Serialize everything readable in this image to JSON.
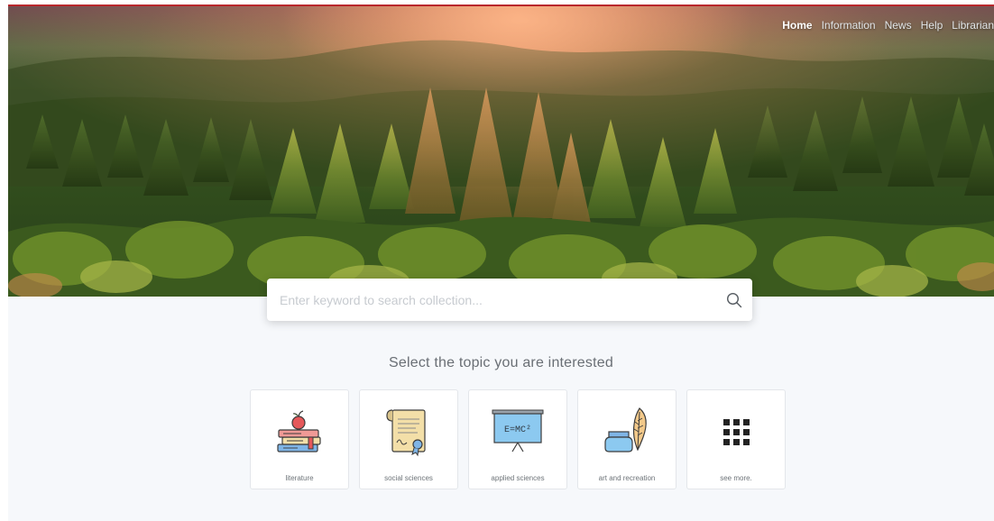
{
  "nav": {
    "items": [
      {
        "label": "Home",
        "active": true
      },
      {
        "label": "Information",
        "active": false
      },
      {
        "label": "News",
        "active": false
      },
      {
        "label": "Help",
        "active": false
      },
      {
        "label": "Librarian",
        "active": false
      }
    ]
  },
  "search": {
    "placeholder": "Enter keyword to search collection...",
    "icon": "search-icon"
  },
  "topics": {
    "heading": "Select the topic you are interested",
    "items": [
      {
        "label": "literature",
        "icon": "books-apple-icon"
      },
      {
        "label": "social sciences",
        "icon": "certificate-scroll-icon"
      },
      {
        "label": "applied sciences",
        "icon": "whiteboard-formula-icon"
      },
      {
        "label": "art and recreation",
        "icon": "ink-feather-icon"
      },
      {
        "label": "see more.",
        "icon": "grid-dots-icon"
      }
    ],
    "formula_text": "E=MC²"
  },
  "colors": {
    "accent_rule": "#b9272c",
    "page_bg": "#f6f8fb"
  }
}
